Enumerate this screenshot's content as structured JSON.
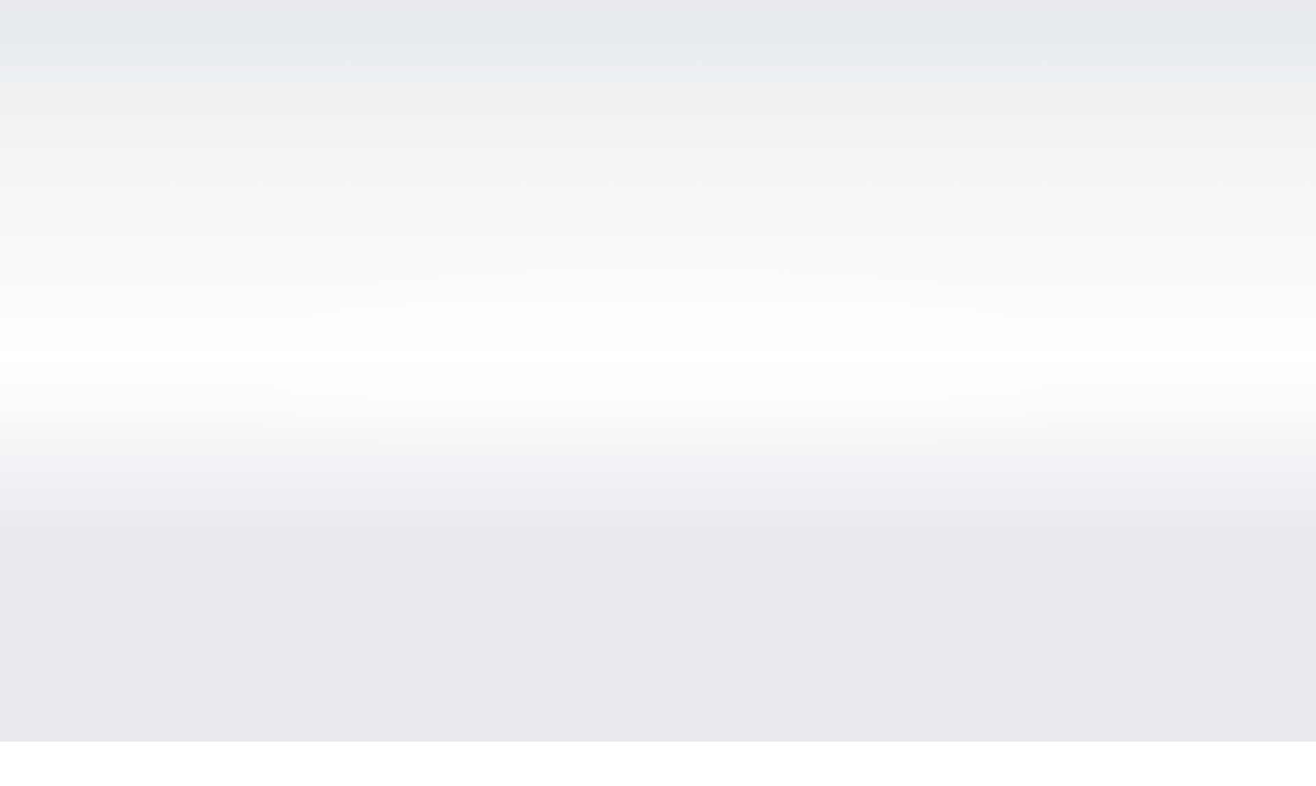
{
  "colors": {
    "backdrop_top": "#e9ebef",
    "backdrop_highlight": "#ffffff",
    "backdrop_bottom": "#eaebef",
    "bottom_strip": "#ffffff"
  }
}
